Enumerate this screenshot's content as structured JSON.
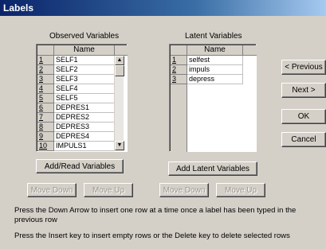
{
  "window": {
    "title": "Labels"
  },
  "observed": {
    "heading": "Observed Variables",
    "column": "Name",
    "rows": [
      {
        "num": "1",
        "name": "SELF1"
      },
      {
        "num": "2",
        "name": "SELF2"
      },
      {
        "num": "3",
        "name": "SELF3"
      },
      {
        "num": "4",
        "name": "SELF4"
      },
      {
        "num": "5",
        "name": "SELF5"
      },
      {
        "num": "6",
        "name": "DEPRES1"
      },
      {
        "num": "7",
        "name": "DEPRES2"
      },
      {
        "num": "8",
        "name": "DEPRES3"
      },
      {
        "num": "9",
        "name": "DEPRES4"
      },
      {
        "num": "10",
        "name": "IMPULS1"
      }
    ],
    "add_button": "Add/Read Variables",
    "move_down": "Move Down",
    "move_up": "Move Up"
  },
  "latent": {
    "heading": "Latent Variables",
    "column": "Name",
    "rows": [
      {
        "num": "1",
        "name": "selfest"
      },
      {
        "num": "2",
        "name": "impuls"
      },
      {
        "num": "3",
        "name": "depress"
      }
    ],
    "add_button": "Add Latent Variables",
    "move_down": "Move Down",
    "move_up": "Move Up"
  },
  "side_buttons": {
    "previous": "< Previous",
    "next": "Next >",
    "ok": "OK",
    "cancel": "Cancel"
  },
  "instructions": {
    "line1": "Press the Down Arrow to insert one row at a time once a label has been typed in the previous row",
    "line2": "Press the Insert key to insert empty rows or the Delete key to delete selected rows"
  }
}
